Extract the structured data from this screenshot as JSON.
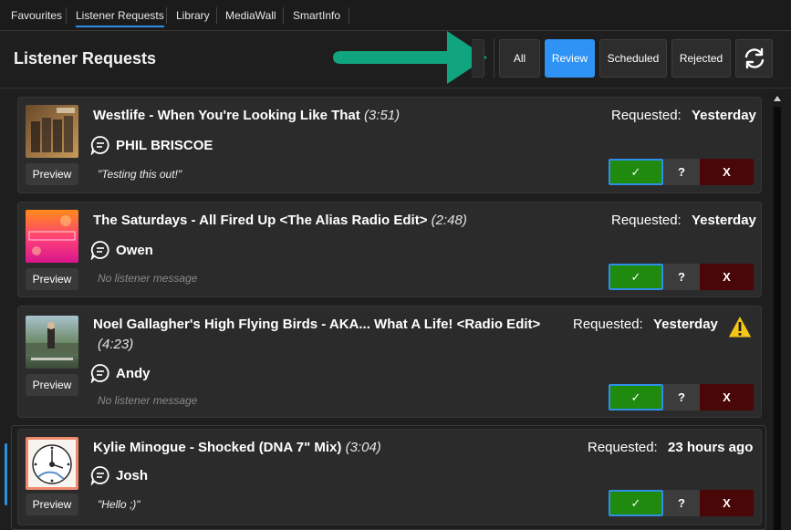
{
  "tabs": [
    {
      "label": "Favourites"
    },
    {
      "label": "Listener Requests"
    },
    {
      "label": "Library"
    },
    {
      "label": "MediaWall"
    },
    {
      "label": "SmartInfo"
    }
  ],
  "header": {
    "title": "Listener Requests"
  },
  "filters": [
    {
      "label": "All"
    },
    {
      "label": "Review"
    },
    {
      "label": "Scheduled"
    },
    {
      "label": "Rejected"
    }
  ],
  "accent_color": "#2f93f5",
  "annotation_arrow_color": "#10a57e",
  "refresh_icon": "refresh-icon",
  "requests": [
    {
      "song": "Westlife - When You're Looking Like That",
      "duration": "(3:51)",
      "requested_label": "Requested:",
      "requested_when": "Yesterday",
      "listener": "PHIL BRISCOE",
      "message": "\"Testing this out!\"",
      "preview": "Preview",
      "approve": "✓",
      "question": "?",
      "reject": "X"
    },
    {
      "song": "The Saturdays - All Fired Up <The Alias Radio Edit>",
      "duration": "(2:48)",
      "requested_label": "Requested:",
      "requested_when": "Yesterday",
      "listener": "Owen",
      "message": "No listener message",
      "preview": "Preview",
      "approve": "✓",
      "question": "?",
      "reject": "X"
    },
    {
      "song": "Noel Gallagher's High Flying Birds - AKA... What A Life! <Radio Edit>",
      "duration": "(4:23)",
      "requested_label": "Requested:",
      "requested_when": "Yesterday",
      "listener": "Andy",
      "message": "No listener message",
      "preview": "Preview",
      "approve": "✓",
      "question": "?",
      "reject": "X",
      "warning_icon": "warning-icon"
    },
    {
      "song": "Kylie Minogue - Shocked (DNA 7\" Mix)",
      "duration": "(3:04)",
      "requested_label": "Requested:",
      "requested_when": "23 hours ago",
      "listener": "Josh",
      "message": "\"Hello ;)\"",
      "preview": "Preview",
      "approve": "✓",
      "question": "?",
      "reject": "X"
    }
  ]
}
